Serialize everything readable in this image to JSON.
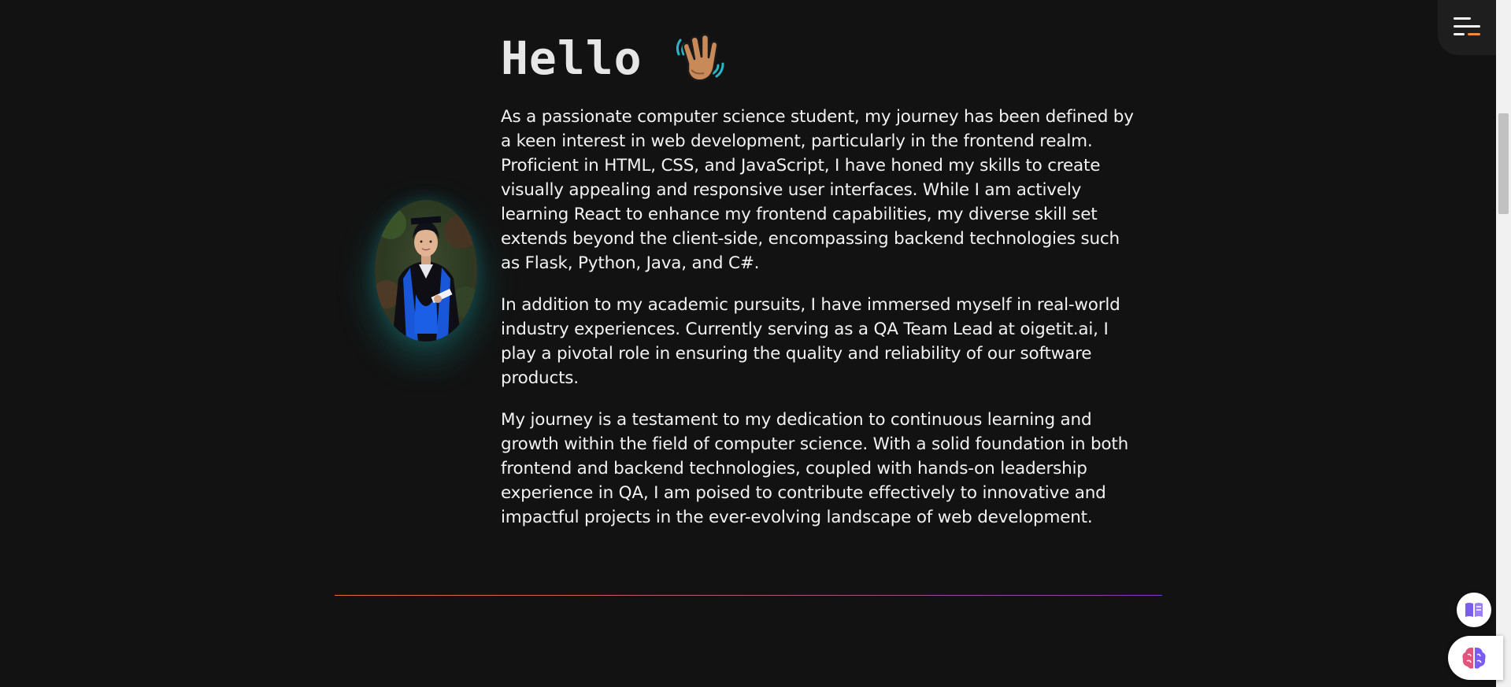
{
  "about": {
    "heading": "Hello",
    "heading_icon": "waving-hand-icon",
    "paragraphs": [
      "As a passionate computer science student, my journey has been defined by a keen interest in web development, particularly in the frontend realm. Proficient in HTML, CSS, and JavaScript, I have honed my skills to create visually appealing and responsive user interfaces. While I am actively learning React to enhance my frontend capabilities, my diverse skill set extends beyond the client-side, encompassing backend technologies such as Flask, Python, Java, and C#.",
      "In addition to my academic pursuits, I have immersed myself in real-world industry experiences. Currently serving as a QA Team Lead at oigetit.ai, I play a pivotal role in ensuring the quality and reliability of our software products.",
      "My journey is a testament to my dedication to continuous learning and growth within the field of computer science. With a solid foundation in both frontend and backend technologies, coupled with hands-on leadership experience in QA, I am poised to contribute effectively to innovative and impactful projects in the ever-evolving landscape of web development."
    ]
  },
  "menu": {
    "icon": "hamburger-menu-icon",
    "accent_color": "#f08a3c"
  },
  "floating": {
    "reader_icon": "open-book-icon",
    "assistant_icon": "brain-icon"
  },
  "colors": {
    "background": "#121212",
    "text": "#f2f2f2",
    "divider_start": "#d9763a",
    "divider_end": "#7a3fb8"
  }
}
